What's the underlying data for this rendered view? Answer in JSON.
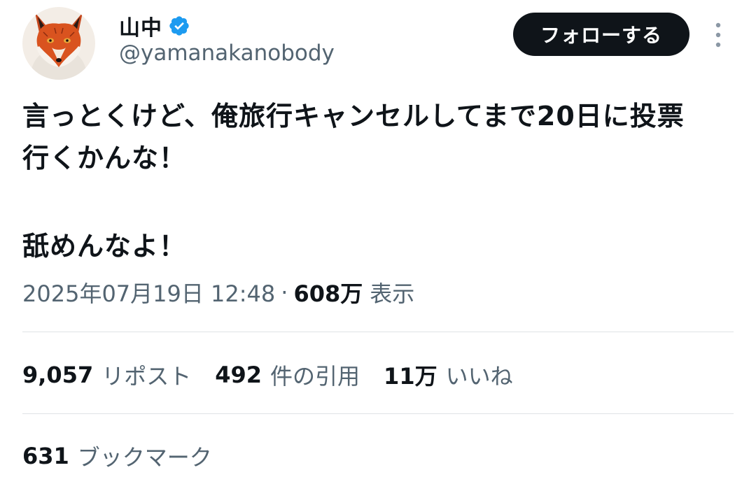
{
  "author": {
    "display_name": "山中",
    "handle": "@yamanakanobody",
    "verified": true,
    "avatar_icon": "fox-avatar-icon",
    "verified_icon": "verified-badge-icon"
  },
  "actions": {
    "follow_label": "フォローする",
    "more_icon": "more-vertical-icon"
  },
  "tweet": {
    "lines": [
      "言っとくけど、俺旅行キャンセルしてまで20日に投票",
      "行くかんな！",
      "",
      "舐めんなよ！"
    ]
  },
  "meta": {
    "timestamp": "2025年07月19日 12:48",
    "separator": "·",
    "views_count": "608万",
    "views_label": "表示"
  },
  "stats": {
    "reposts": {
      "count": "9,057",
      "label": "リポスト"
    },
    "quotes": {
      "count": "492",
      "label": "件の引用"
    },
    "likes": {
      "count": "11万",
      "label": "いいね"
    },
    "bookmarks": {
      "count": "631",
      "label": "ブックマーク"
    }
  },
  "colors": {
    "text_primary": "#0f1419",
    "text_secondary": "#536471",
    "verified_blue": "#1d9bf0",
    "follow_bg": "#0f1419",
    "divider": "#dfe3e6"
  }
}
